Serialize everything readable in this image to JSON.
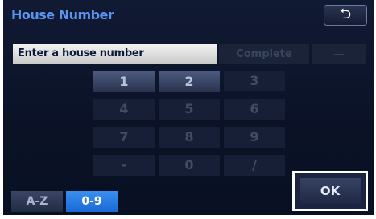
{
  "header": {
    "title": "House Number",
    "back_icon": "return-arrow-icon"
  },
  "entry": {
    "placeholder": "Enter a house number",
    "complete_label": "Complete",
    "delete_label": "—"
  },
  "keypad": {
    "keys": [
      "1",
      "2",
      "3",
      "4",
      "5",
      "6",
      "7",
      "8",
      "9",
      "-",
      "0",
      "/"
    ]
  },
  "footer": {
    "az_label": "A-Z",
    "numeric_label": "0-9",
    "ok_label": "OK"
  },
  "colors": {
    "title": "#5b93f0",
    "active_tab": "#2a80ea",
    "background": "#0b1226"
  }
}
